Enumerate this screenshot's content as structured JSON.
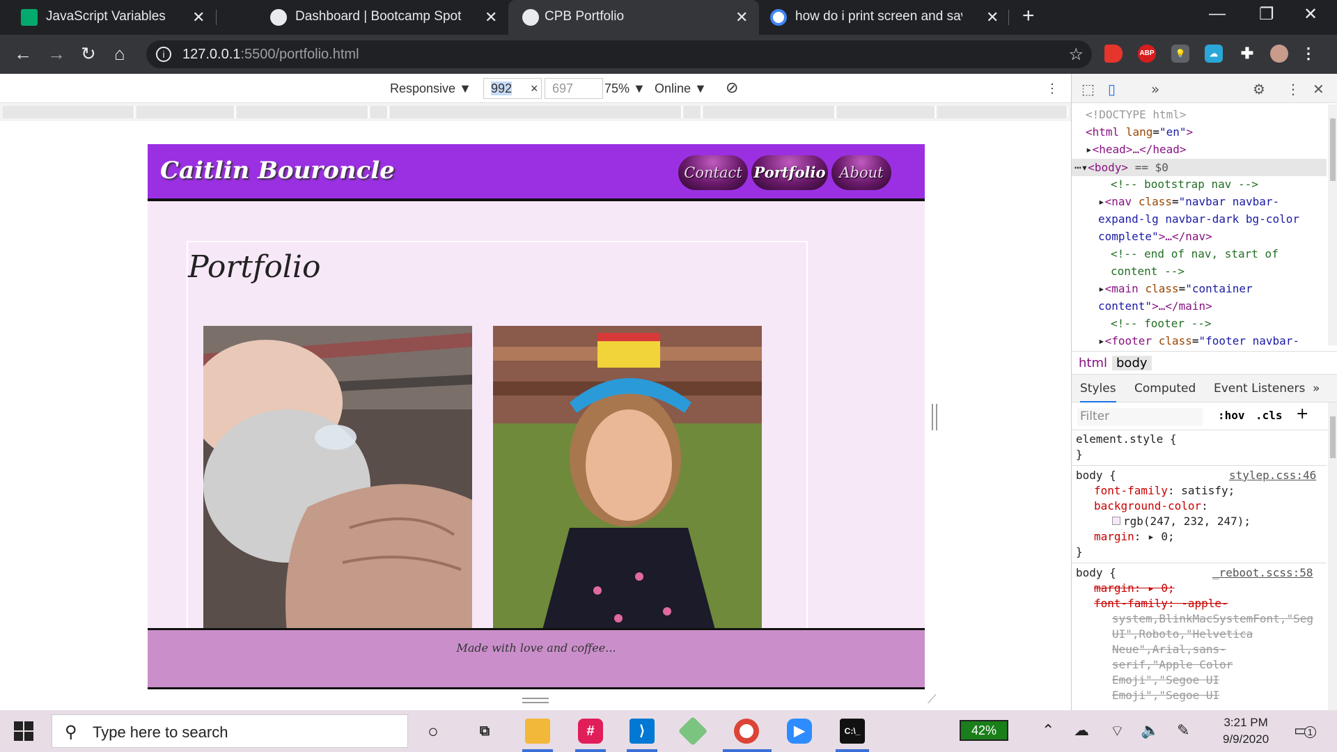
{
  "browser": {
    "tabs": [
      {
        "title": "JavaScript Variables",
        "icon": "w3schools-icon",
        "color": "#04aa6d"
      },
      {
        "title": "Dashboard | Bootcamp Spot",
        "icon": "globe-icon",
        "color": "#e8eaed"
      },
      {
        "title": "CPB Portfolio",
        "icon": "globe-icon",
        "color": "#e8eaed",
        "active": true
      },
      {
        "title": "how do i print screen and save to",
        "icon": "google-icon",
        "color": "#4285f4"
      }
    ],
    "url_host": "127.0.0.1",
    "url_path": ":5500/portfolio.html"
  },
  "device_toolbar": {
    "mode": "Responsive",
    "width": "992",
    "height": "697",
    "times": "×",
    "zoom": "75%",
    "network": "Online"
  },
  "site": {
    "brand": "Caitlin Bouroncle",
    "nav": [
      "Contact",
      "Portfolio",
      "About"
    ],
    "active_nav": "Portfolio",
    "heading": "Portfolio",
    "footer_text": "Made with love and coffee...",
    "colors": {
      "navbar": "#9b30e3",
      "background": "#f7e8f7",
      "footer": "#ca8fca"
    }
  },
  "devtools": {
    "dom": {
      "doctype": "<!DOCTYPE html>",
      "html_open": "<html",
      "html_lang_attr": "lang",
      "html_lang_val": "\"en\"",
      "head": "<head>…</head>",
      "body_tag": "<body>",
      "body_sel": "== $0",
      "c1": "<!-- bootstrap nav -->",
      "nav_open": "<nav",
      "nav_class": "class",
      "nav_val1": "\"navbar navbar-",
      "nav_val2": "expand-lg navbar-dark bg-color",
      "nav_val3": "complete\"",
      "nav_close": ">…</nav>",
      "c2a": "<!-- end of nav, start of",
      "c2b": "content -->",
      "main_open": "<main",
      "main_class": "class",
      "main_val1": "\"container",
      "main_val2": "content\"",
      "main_close": ">…</main>",
      "c3": "<!-- footer -->",
      "footer_open": "<footer",
      "footer_class": "class",
      "footer_val": "\"footer navbar-"
    },
    "breadcrumbs": [
      "html",
      "body"
    ],
    "panel_tabs": [
      "Styles",
      "Computed",
      "Event Listeners"
    ],
    "filter_placeholder": "Filter",
    "hov": ":hov",
    "cls": ".cls",
    "styles": {
      "element_style": "element.style {",
      "close": "}",
      "rule1_selector": "body {",
      "rule1_src": "stylep.css:46",
      "rule1_p1": "font-family",
      "rule1_v1": ": satisfy;",
      "rule1_p2": "background-color",
      "rule1_v2_colon": ":",
      "rule1_v2": "rgb(247, 232, 247);",
      "rule1_p3": "margin",
      "rule1_v3": ": ▸ 0;",
      "rule2_selector": "body {",
      "rule2_src": "_reboot.scss:58",
      "rule2_l1": "margin: ▸ 0;",
      "rule2_l2": "font-family: -apple-",
      "rule2_l3": "system,BlinkMacSystemFont,\"Seg",
      "rule2_l4": "UI\",Roboto,\"Helvetica",
      "rule2_l5": "Neue\",Arial,sans-",
      "rule2_l6": "serif,\"Apple Color",
      "rule2_l7": "Emoji\",\"Segoe UI",
      "rule2_l8": "Emoji\",\"Segoe UI"
    }
  },
  "taskbar": {
    "search_placeholder": "Type here to search",
    "battery": "42%",
    "time": "3:21 PM",
    "date": "9/9/2020",
    "notifications": "1"
  }
}
